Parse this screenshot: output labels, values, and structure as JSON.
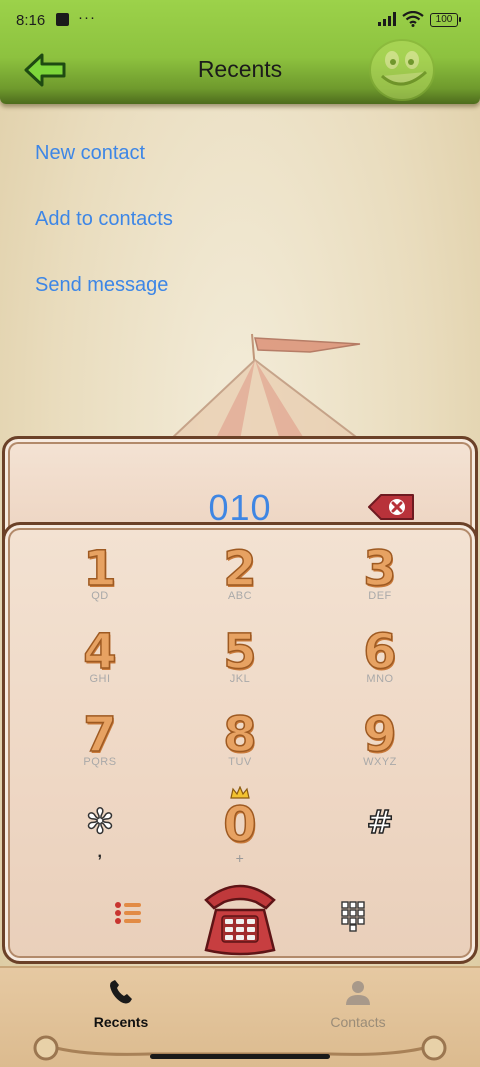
{
  "status_bar": {
    "time": "8:16",
    "dots": "···",
    "battery": "100"
  },
  "header": {
    "title": "Recents"
  },
  "actions": [
    {
      "label": "New contact"
    },
    {
      "label": "Add to contacts"
    },
    {
      "label": "Send message"
    }
  ],
  "dialer": {
    "number": "010",
    "keys": [
      {
        "digit": "1",
        "letters": "QD"
      },
      {
        "digit": "2",
        "letters": "ABC"
      },
      {
        "digit": "3",
        "letters": "DEF"
      },
      {
        "digit": "4",
        "letters": "GHI"
      },
      {
        "digit": "5",
        "letters": "JKL"
      },
      {
        "digit": "6",
        "letters": "MNO"
      },
      {
        "digit": "7",
        "letters": "PQRS"
      },
      {
        "digit": "8",
        "letters": "TUV"
      },
      {
        "digit": "9",
        "letters": "WXYZ"
      },
      {
        "digit": "✻",
        "letters": ","
      },
      {
        "digit": "0",
        "letters": "+"
      },
      {
        "digit": "#",
        "letters": ""
      }
    ]
  },
  "bottom_nav": {
    "recents_label": "Recents",
    "contacts_label": "Contacts"
  },
  "colors": {
    "header_green": "#8dc23f",
    "link_blue": "#3d86e6",
    "digit_orange": "#e7a262",
    "panel_border": "#6b4128",
    "phone_red": "#c0393b"
  },
  "icons": {
    "back": "back-arrow-icon",
    "delete": "backspace-icon",
    "menu": "list-menu-icon",
    "call": "telephone-icon",
    "keypad": "keypad-grid-icon",
    "recents": "phone-handset-icon",
    "contacts": "person-icon"
  }
}
